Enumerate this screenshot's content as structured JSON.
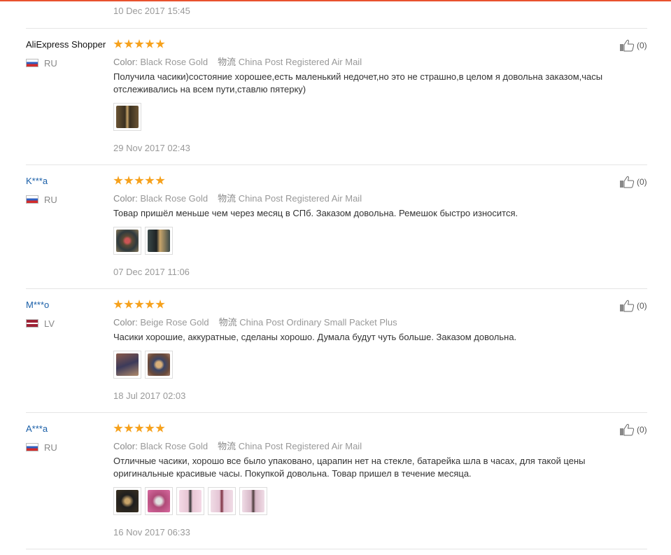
{
  "first_date": "10 Dec 2017 15:45",
  "labels": {
    "color": "Color:",
    "shipping": "物流"
  },
  "reviews": [
    {
      "user": "AliExpress Shopper",
      "country": "RU",
      "color": "Black Rose Gold",
      "shipping": "China Post Registered Air Mail",
      "text": "Получила часики)состояние хорошее,есть маленький недочет,но это не страшно,в целом я довольна заказом,часы отслеживались на всем пути,ставлю пятерку)",
      "photos": 1,
      "date": "29 Nov 2017 02:43",
      "helpful": "(0)",
      "rating": 5
    },
    {
      "user": "K***a",
      "country": "RU",
      "color": "Black Rose Gold",
      "shipping": "China Post Registered Air Mail",
      "text": "Товар пришёл меньше чем через месяц в СПб. Заказом довольна. Ремешок быстро износится.",
      "photos": 2,
      "date": "07 Dec 2017 11:06",
      "helpful": "(0)",
      "rating": 5
    },
    {
      "user": "M***o",
      "country": "LV",
      "color": "Beige Rose Gold",
      "shipping": "China Post Ordinary Small Packet Plus",
      "text": "Часики хорошие, аккуратные, сделаны хорошо. Думала будут чуть больше. Заказом довольна.",
      "photos": 2,
      "date": "18 Jul 2017 02:03",
      "helpful": "(0)",
      "rating": 5
    },
    {
      "user": "A***a",
      "country": "RU",
      "color": "Black Rose Gold",
      "shipping": "China Post Registered Air Mail",
      "text": "Отличные часики, хорошо все было упаковано, царапин нет на стекле, батарейка шла в часах, для такой цены оригинальные красивые часы. Покупкой довольна. Товар пришел в течение месяца.",
      "photos": 5,
      "date": "16 Nov 2017 06:33",
      "helpful": "(0)",
      "rating": 5
    }
  ]
}
